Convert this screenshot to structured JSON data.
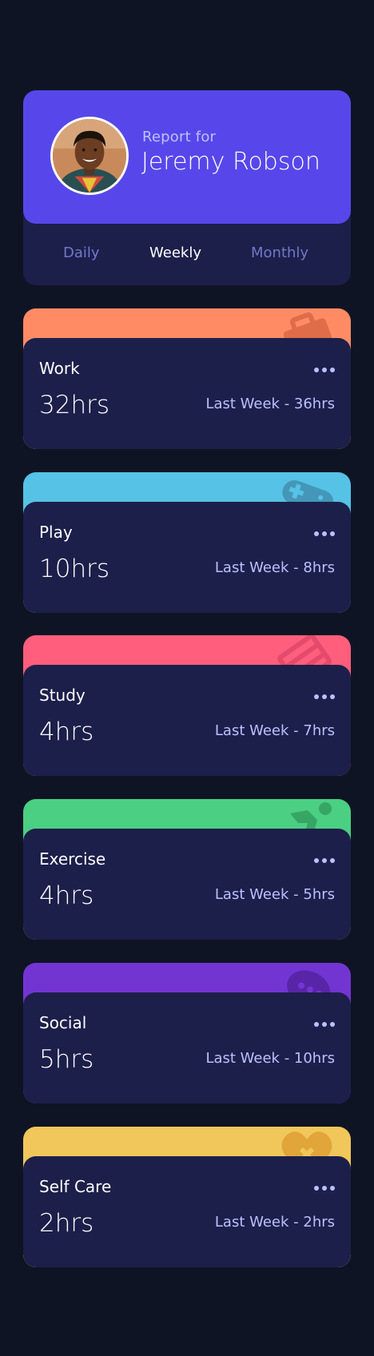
{
  "profile": {
    "report_label": "Report for",
    "name": "Jeremy Robson",
    "avatar_icon": "user-avatar-photo"
  },
  "periods": {
    "active": "Weekly",
    "items": [
      {
        "label": "Daily"
      },
      {
        "label": "Weekly"
      },
      {
        "label": "Monthly"
      }
    ]
  },
  "activities": [
    {
      "title": "Work",
      "current": "32hrs",
      "previous": "Last Week - 36hrs",
      "color": "#ff8b64",
      "icon": "briefcase-icon"
    },
    {
      "title": "Play",
      "current": "10hrs",
      "previous": "Last Week - 8hrs",
      "color": "#55c2e6",
      "icon": "gamepad-icon"
    },
    {
      "title": "Study",
      "current": "4hrs",
      "previous": "Last Week - 7hrs",
      "color": "#ff5e7d",
      "icon": "book-icon"
    },
    {
      "title": "Exercise",
      "current": "4hrs",
      "previous": "Last Week - 5hrs",
      "color": "#4bcf82",
      "icon": "runner-icon"
    },
    {
      "title": "Social",
      "current": "5hrs",
      "previous": "Last Week - 10hrs",
      "color": "#7335d2",
      "icon": "chat-icon"
    },
    {
      "title": "Self Care",
      "current": "2hrs",
      "previous": "Last Week - 2hrs",
      "color": "#f1c75b",
      "icon": "heart-icon"
    }
  ],
  "colors": {
    "page_bg": "#0f1424",
    "card_bg": "#1c1f4a",
    "profile_accent": "#5747ea",
    "muted_text": "#bbc0ff",
    "tab_inactive": "#7078c9"
  }
}
